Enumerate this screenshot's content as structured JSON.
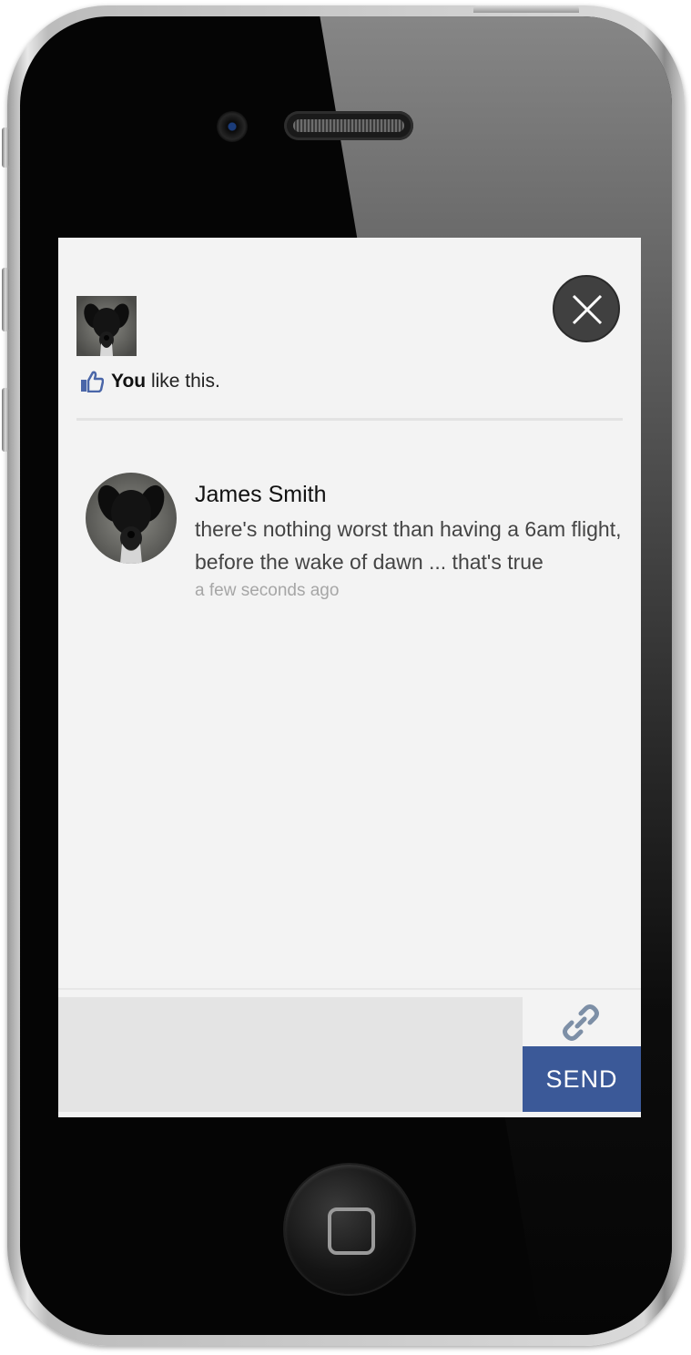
{
  "likes": {
    "you_label": "You",
    "rest_label": "like this."
  },
  "comment": {
    "author": "James Smith",
    "text": "there's nothing worst than having a 6am flight, before the wake of dawn ... that's true",
    "time": "a few seconds ago"
  },
  "composer": {
    "value": "",
    "send_label": "SEND"
  },
  "icons": {
    "close": "close-icon",
    "like": "thumbs-up-icon",
    "attach": "link-icon"
  },
  "colors": {
    "accent": "#3b5998",
    "close_button": "#404040",
    "screen_bg": "#f3f3f3"
  }
}
